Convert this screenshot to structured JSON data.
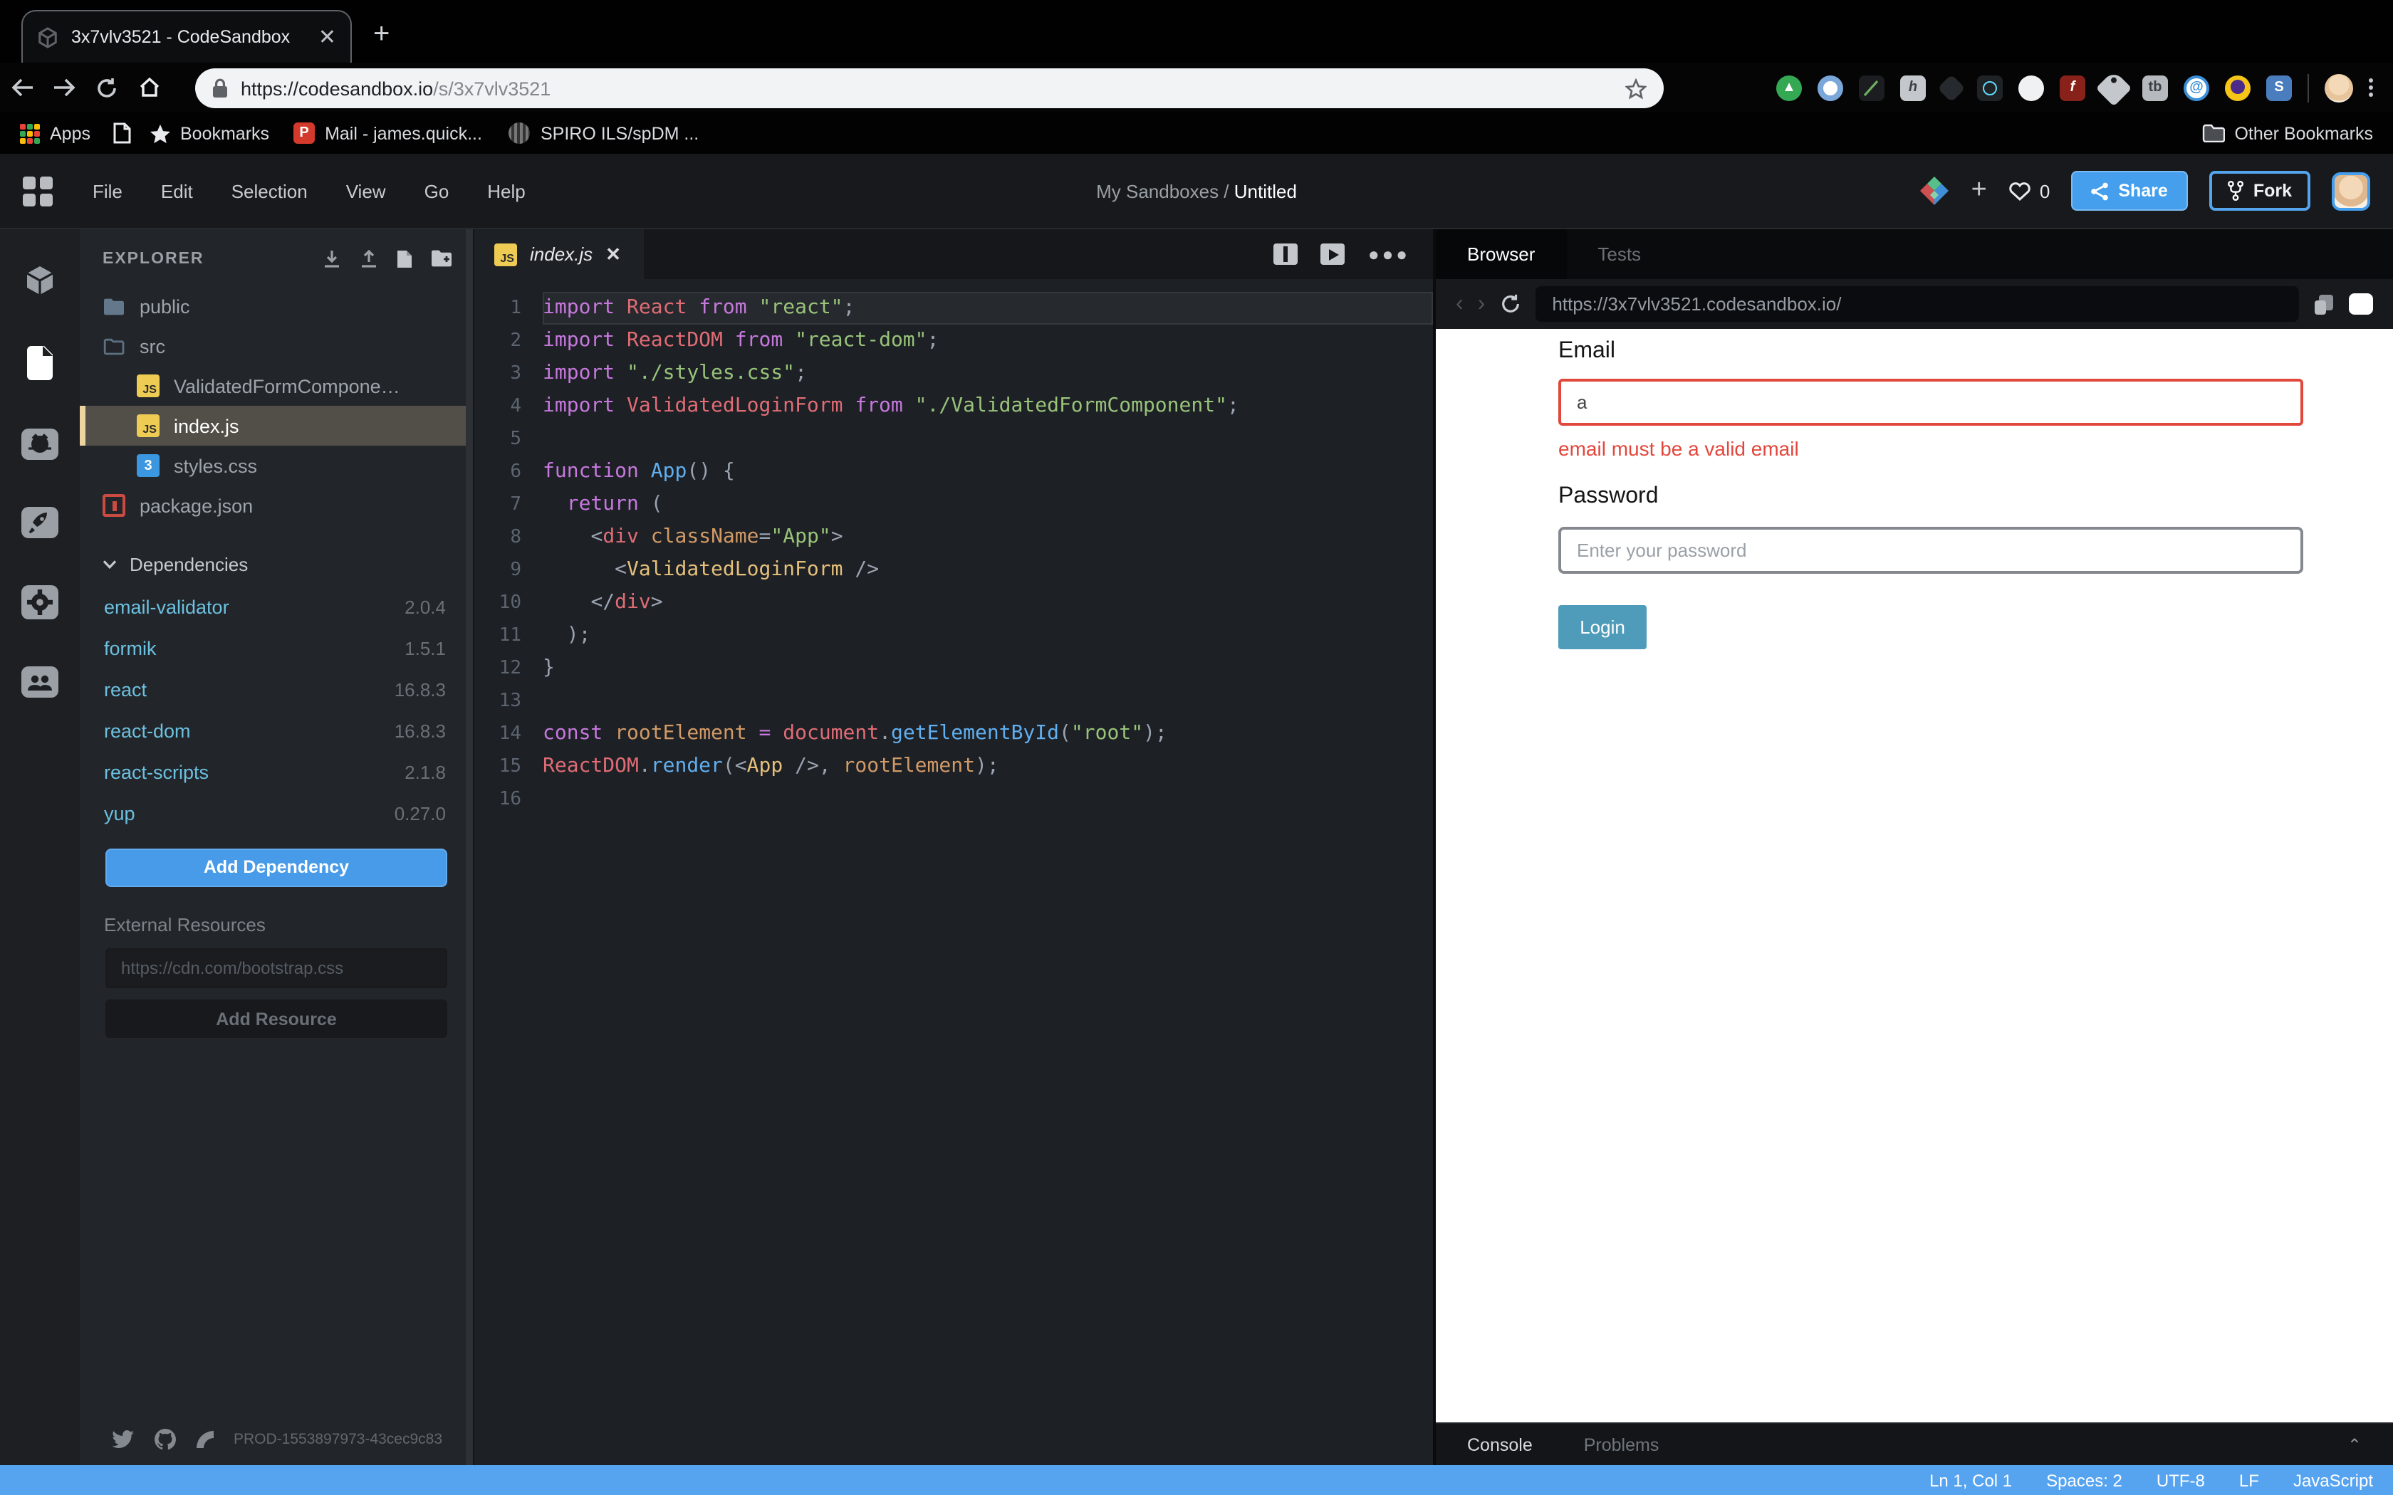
{
  "browser": {
    "tab_title": "3x7vlv3521 - CodeSandbox",
    "url_domain": "https://codesandbox.io",
    "url_path": "/s/3x7vlv3521",
    "bookmarks": {
      "apps": "Apps",
      "bookmarks": "Bookmarks",
      "mail": "Mail - james.quick...",
      "spiro": "SPIRO ILS/spDM ...",
      "other": "Other Bookmarks"
    }
  },
  "menubar": {
    "items": {
      "file": "File",
      "edit": "Edit",
      "selection": "Selection",
      "view": "View",
      "go": "Go",
      "help": "Help"
    },
    "breadcrumb_parent": "My Sandboxes / ",
    "breadcrumb_title": "Untitled",
    "like_count": "0",
    "share_label": "Share",
    "fork_label": "Fork"
  },
  "explorer": {
    "title": "EXPLORER",
    "files": [
      {
        "name": "public"
      },
      {
        "name": "src"
      },
      {
        "name": "ValidatedFormCompone…"
      },
      {
        "name": "index.js"
      },
      {
        "name": "styles.css"
      },
      {
        "name": "package.json"
      }
    ],
    "dependencies_title": "Dependencies",
    "dependencies": [
      {
        "name": "email-validator",
        "version": "2.0.4"
      },
      {
        "name": "formik",
        "version": "1.5.1"
      },
      {
        "name": "react",
        "version": "16.8.3"
      },
      {
        "name": "react-dom",
        "version": "16.8.3"
      },
      {
        "name": "react-scripts",
        "version": "2.1.8"
      },
      {
        "name": "yup",
        "version": "0.27.0"
      }
    ],
    "add_dependency_label": "Add Dependency",
    "external_resources_label": "External Resources",
    "resource_placeholder": "https://cdn.com/bootstrap.css",
    "add_resource_label": "Add Resource",
    "build_id": "PROD-1553897973-43cec9c83"
  },
  "editor": {
    "tab_name": "index.js",
    "code_lines": [
      [
        [
          "kw",
          "import"
        ],
        [
          "pln",
          " "
        ],
        [
          "id",
          "React"
        ],
        [
          "pln",
          " "
        ],
        [
          "kw",
          "from"
        ],
        [
          "pln",
          " "
        ],
        [
          "str",
          "\"react\""
        ],
        [
          "pun",
          ";"
        ]
      ],
      [
        [
          "kw",
          "import"
        ],
        [
          "pln",
          " "
        ],
        [
          "id",
          "ReactDOM"
        ],
        [
          "pln",
          " "
        ],
        [
          "kw",
          "from"
        ],
        [
          "pln",
          " "
        ],
        [
          "str",
          "\"react-dom\""
        ],
        [
          "pun",
          ";"
        ]
      ],
      [
        [
          "kw",
          "import"
        ],
        [
          "pln",
          " "
        ],
        [
          "str",
          "\"./styles.css\""
        ],
        [
          "pun",
          ";"
        ]
      ],
      [
        [
          "kw",
          "import"
        ],
        [
          "pln",
          " "
        ],
        [
          "id",
          "ValidatedLoginForm"
        ],
        [
          "pln",
          " "
        ],
        [
          "kw",
          "from"
        ],
        [
          "pln",
          " "
        ],
        [
          "str",
          "\"./ValidatedFormComponent\""
        ],
        [
          "pun",
          ";"
        ]
      ],
      [],
      [
        [
          "kw",
          "function"
        ],
        [
          "pln",
          " "
        ],
        [
          "fn",
          "App"
        ],
        [
          "pun",
          "() {"
        ]
      ],
      [
        [
          "pln",
          "  "
        ],
        [
          "kw",
          "return"
        ],
        [
          "pun",
          " ("
        ]
      ],
      [
        [
          "pln",
          "    "
        ],
        [
          "pun",
          "<"
        ],
        [
          "id",
          "div"
        ],
        [
          "pln",
          " "
        ],
        [
          "var",
          "className"
        ],
        [
          "pun",
          "="
        ],
        [
          "str",
          "\"App\""
        ],
        [
          "pun",
          ">"
        ]
      ],
      [
        [
          "pln",
          "      "
        ],
        [
          "pun",
          "<"
        ],
        [
          "cmp",
          "ValidatedLoginForm"
        ],
        [
          "pln",
          " "
        ],
        [
          "pun",
          "/>"
        ]
      ],
      [
        [
          "pln",
          "    "
        ],
        [
          "pun",
          "</"
        ],
        [
          "id",
          "div"
        ],
        [
          "pun",
          ">"
        ]
      ],
      [
        [
          "pln",
          "  "
        ],
        [
          "pun",
          ");"
        ]
      ],
      [
        [
          "pun",
          "}"
        ]
      ],
      [],
      [
        [
          "kw",
          "const"
        ],
        [
          "pln",
          " "
        ],
        [
          "var",
          "rootElement"
        ],
        [
          "pln",
          " "
        ],
        [
          "kw",
          "="
        ],
        [
          "pln",
          " "
        ],
        [
          "id",
          "document"
        ],
        [
          "pun",
          "."
        ],
        [
          "fn",
          "getElementById"
        ],
        [
          "pun",
          "("
        ],
        [
          "str",
          "\"root\""
        ],
        [
          "pun",
          ");"
        ]
      ],
      [
        [
          "id",
          "ReactDOM"
        ],
        [
          "pun",
          "."
        ],
        [
          "fn",
          "render"
        ],
        [
          "pun",
          "(<"
        ],
        [
          "cmp",
          "App"
        ],
        [
          "pln",
          " "
        ],
        [
          "pun",
          "/>, "
        ],
        [
          "var",
          "rootElement"
        ],
        [
          "pun",
          ");"
        ]
      ],
      []
    ]
  },
  "preview": {
    "tab_browser": "Browser",
    "tab_tests": "Tests",
    "url": "https://3x7vlv3521.codesandbox.io/",
    "form": {
      "email_label": "Email",
      "email_value": "a",
      "email_error": "email must be a valid email",
      "password_label": "Password",
      "password_placeholder": "Enter your password",
      "login_label": "Login"
    },
    "console_label": "Console",
    "problems_label": "Problems"
  },
  "statusbar": {
    "items": [
      "Ln 1, Col 1",
      "Spaces: 2",
      "UTF-8",
      "LF",
      "JavaScript"
    ]
  },
  "colors": {
    "accent_blue": "#459fec",
    "status_bar_blue": "#56a4f0",
    "error_red": "#e2473c",
    "login_teal": "#4e9cb9",
    "js_yellow": "#eecb53"
  }
}
